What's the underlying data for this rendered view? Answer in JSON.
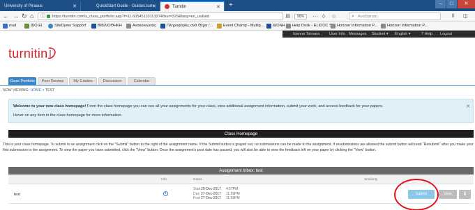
{
  "browser": {
    "tabs": [
      {
        "title": "University of Piraeus"
      },
      {
        "title": "QuickStart Guide - Guides.turn"
      },
      {
        "title": "Turnitin"
      }
    ],
    "url": "https://turnitin.com/s_class_portfolio.asp?r=11.605451101133748svr=329&lang=en_us&aid",
    "zoom": "90%",
    "search_placeholder": "Αναζήτηση",
    "bookmarks": [
      {
        "label": "mail",
        "color": "#3b6fc4"
      },
      {
        "label": "ΔΙΟ.ΕΙ.",
        "color": "#6a8f3a"
      },
      {
        "label": "SiteDymo Support",
        "color": "#3a86c8"
      },
      {
        "label": "ΒΙΒΛΙΟΘΗΚΗ",
        "color": "#1f4f99"
      },
      {
        "label": "Ανακοινώσεις",
        "color": "#8a8a8a"
      },
      {
        "label": "Πληροφορίες ανά Θέμα /...",
        "color": "#1f4f99"
      },
      {
        "label": "Event Champ - Multip...",
        "color": "#c8a12a"
      },
      {
        "label": "ΔΙΟΝΗ",
        "color": "#1f4f99"
      },
      {
        "label": "Help Desk - ELIDOC Sy...",
        "color": "#8a8a8a"
      },
      {
        "label": "Horizon Information P...",
        "color": "#8a8a8a"
      },
      {
        "label": "Horizon Information P...",
        "color": "#8a8a8a"
      }
    ]
  },
  "tii": {
    "top_links": [
      "Ioanna Tsimara",
      "User Info",
      "Messages",
      "Student ▾",
      "English ▾",
      "? Help",
      "Logout"
    ],
    "logo": "turnitin",
    "brand_color": "#d9232a",
    "tabs": [
      "Class Portfolio",
      "Peer Review",
      "My Grades",
      "Discussion",
      "Calendar"
    ],
    "breadcrumb_prefix": "NOW VIEWING:",
    "breadcrumb_home": "HOME",
    "breadcrumb_sep": ">",
    "breadcrumb_current": "TEST",
    "welcome_bold": "Welcome to your new class homepage!",
    "welcome_text": " From the class homepage you can see all your assignments for your class, view additional assignment information, submit your work, and access feedback for your papers.",
    "welcome_hint": "Hover on any item in the class homepage for more information.",
    "class_homepage_title": "Class Homepage",
    "instructions": "This is your class homepage. To submit to an assignment click on the \"Submit\" button to the right of the assignment name. If the Submit button is grayed out, no submissions can be made to the assignment. If resubmissions are allowed the submit button will read \"Resubmit\" after you make your first submission to the assignment. To view the paper you have submitted, click the \"View\" button. Once the assignment's post date has passed, you will also be able to view the feedback left on your paper by clicking the \"View\" button.",
    "inbox_title": "Assignment Inbox: test",
    "columns": [
      "Info",
      "Dates",
      "Similarity"
    ],
    "assignment": {
      "name": "test",
      "dates": [
        {
          "label": "Start",
          "date": "20-Dec-2017",
          "time": "4:57PM"
        },
        {
          "label": "Due",
          "date": "27-Dec-2017",
          "time": "11:59PM"
        },
        {
          "label": "Post",
          "date": "27-Dec-2017",
          "time": "11:59PM"
        }
      ],
      "submit_label": "Submit",
      "view_label": "View"
    }
  }
}
